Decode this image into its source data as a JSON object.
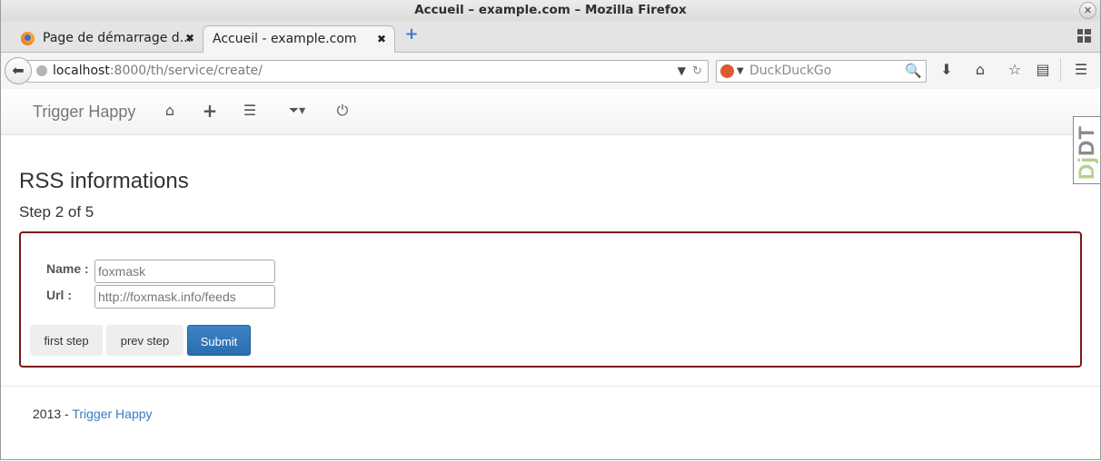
{
  "window": {
    "title": "Accueil – example.com – Mozilla Firefox"
  },
  "tabs": [
    {
      "label": "Page de démarrage d..."
    },
    {
      "label": "Accueil - example.com"
    }
  ],
  "address": {
    "host": "localhost",
    "path": ":8000/th/service/create/"
  },
  "search": {
    "placeholder": "DuckDuckGo"
  },
  "app": {
    "brand": "Trigger Happy",
    "nav_icons": [
      "home-icon",
      "plus-icon",
      "tasks-icon",
      "filter-icon",
      "power-icon"
    ]
  },
  "debug_toolbar": {
    "label_prefix": "Dj",
    "label_suffix": "DT"
  },
  "page": {
    "heading": "RSS informations",
    "step": "Step 2 of 5",
    "form": {
      "name_label": "Name :",
      "name_placeholder": "foxmask",
      "url_label": "Url :",
      "url_placeholder": "http://foxmask.info/feeds",
      "first_step": "first step",
      "prev_step": "prev step",
      "submit": "Submit"
    }
  },
  "footer": {
    "year_prefix": "2013 - ",
    "link": "Trigger Happy"
  },
  "colors": {
    "form_border": "#7a1a1a",
    "primary_button": "#2a6db0",
    "link": "#3a7bc1"
  }
}
